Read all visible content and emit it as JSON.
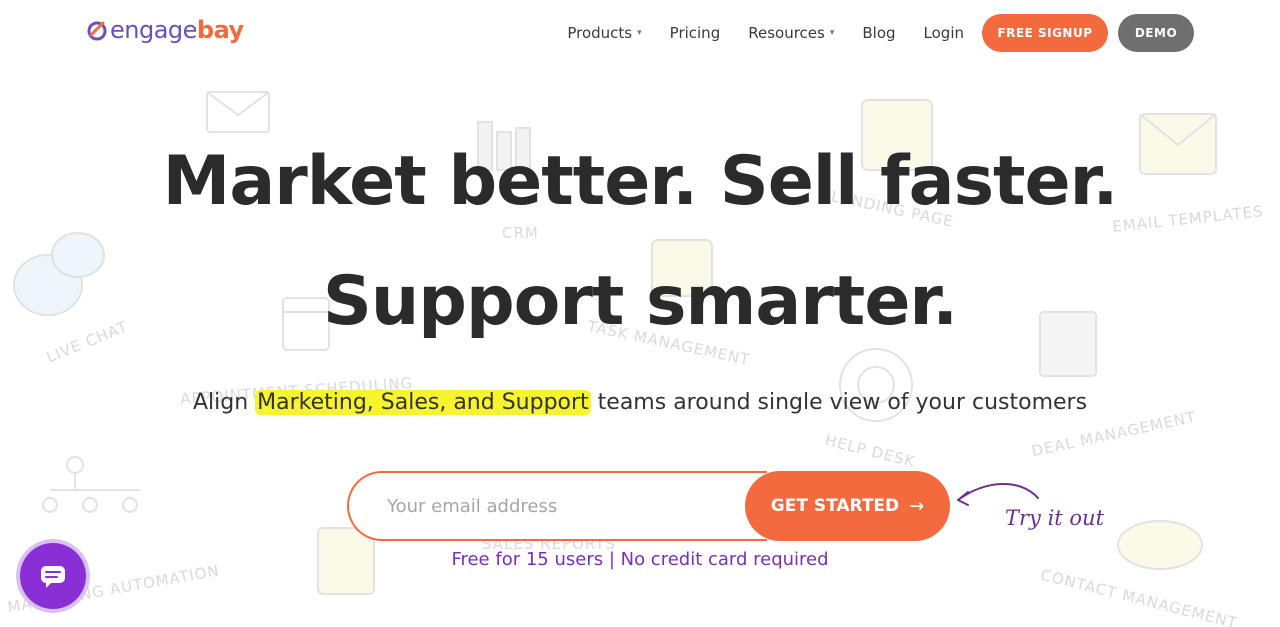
{
  "logo": {
    "part1": "engage",
    "part2": "bay"
  },
  "nav": {
    "products": "Products",
    "pricing": "Pricing",
    "resources": "Resources",
    "blog": "Blog",
    "login": "Login",
    "signup": "FREE SIGNUP",
    "demo": "DEMO"
  },
  "hero": {
    "line1": "Market better. Sell faster.",
    "line2": "Support smarter."
  },
  "subtitle": {
    "prefix": "Align ",
    "highlight": "Marketing, Sales, and Support",
    "suffix": " teams around single view of your customers"
  },
  "form": {
    "email_placeholder": "Your email address",
    "button_label": "GET STARTED",
    "arrow": "→"
  },
  "try_label": "Try it out",
  "note": "Free for 15 users | No credit card required",
  "background_labels": {
    "live_chat": "LIVE CHAT",
    "crm": "CRM",
    "landing_page": "LANDING PAGE",
    "email_templates": "EMAIL TEMPLATES",
    "task_management": "TASK MANAGEMENT",
    "appointment_scheduling": "APPOINTMENT SCHEDULING",
    "help_desk": "HELP DESK",
    "deal_management": "DEAL MANAGEMENT",
    "marketing_automation": "MARKETING AUTOMATION",
    "sales_reports": "SALES REPORTS",
    "contact_management": "CONTACT MANAGEMENT"
  },
  "colors": {
    "brand_orange": "#f26a3d",
    "brand_purple": "#6b4fbb",
    "highlight_yellow": "#f7f32d",
    "note_purple": "#7b2fb5",
    "chat_purple": "#8a2fd6",
    "demo_gray": "#6f6f6f"
  },
  "icons": {
    "caret": "chevron-down-icon",
    "chat": "chat-icon",
    "arrow": "arrow-right-icon"
  }
}
